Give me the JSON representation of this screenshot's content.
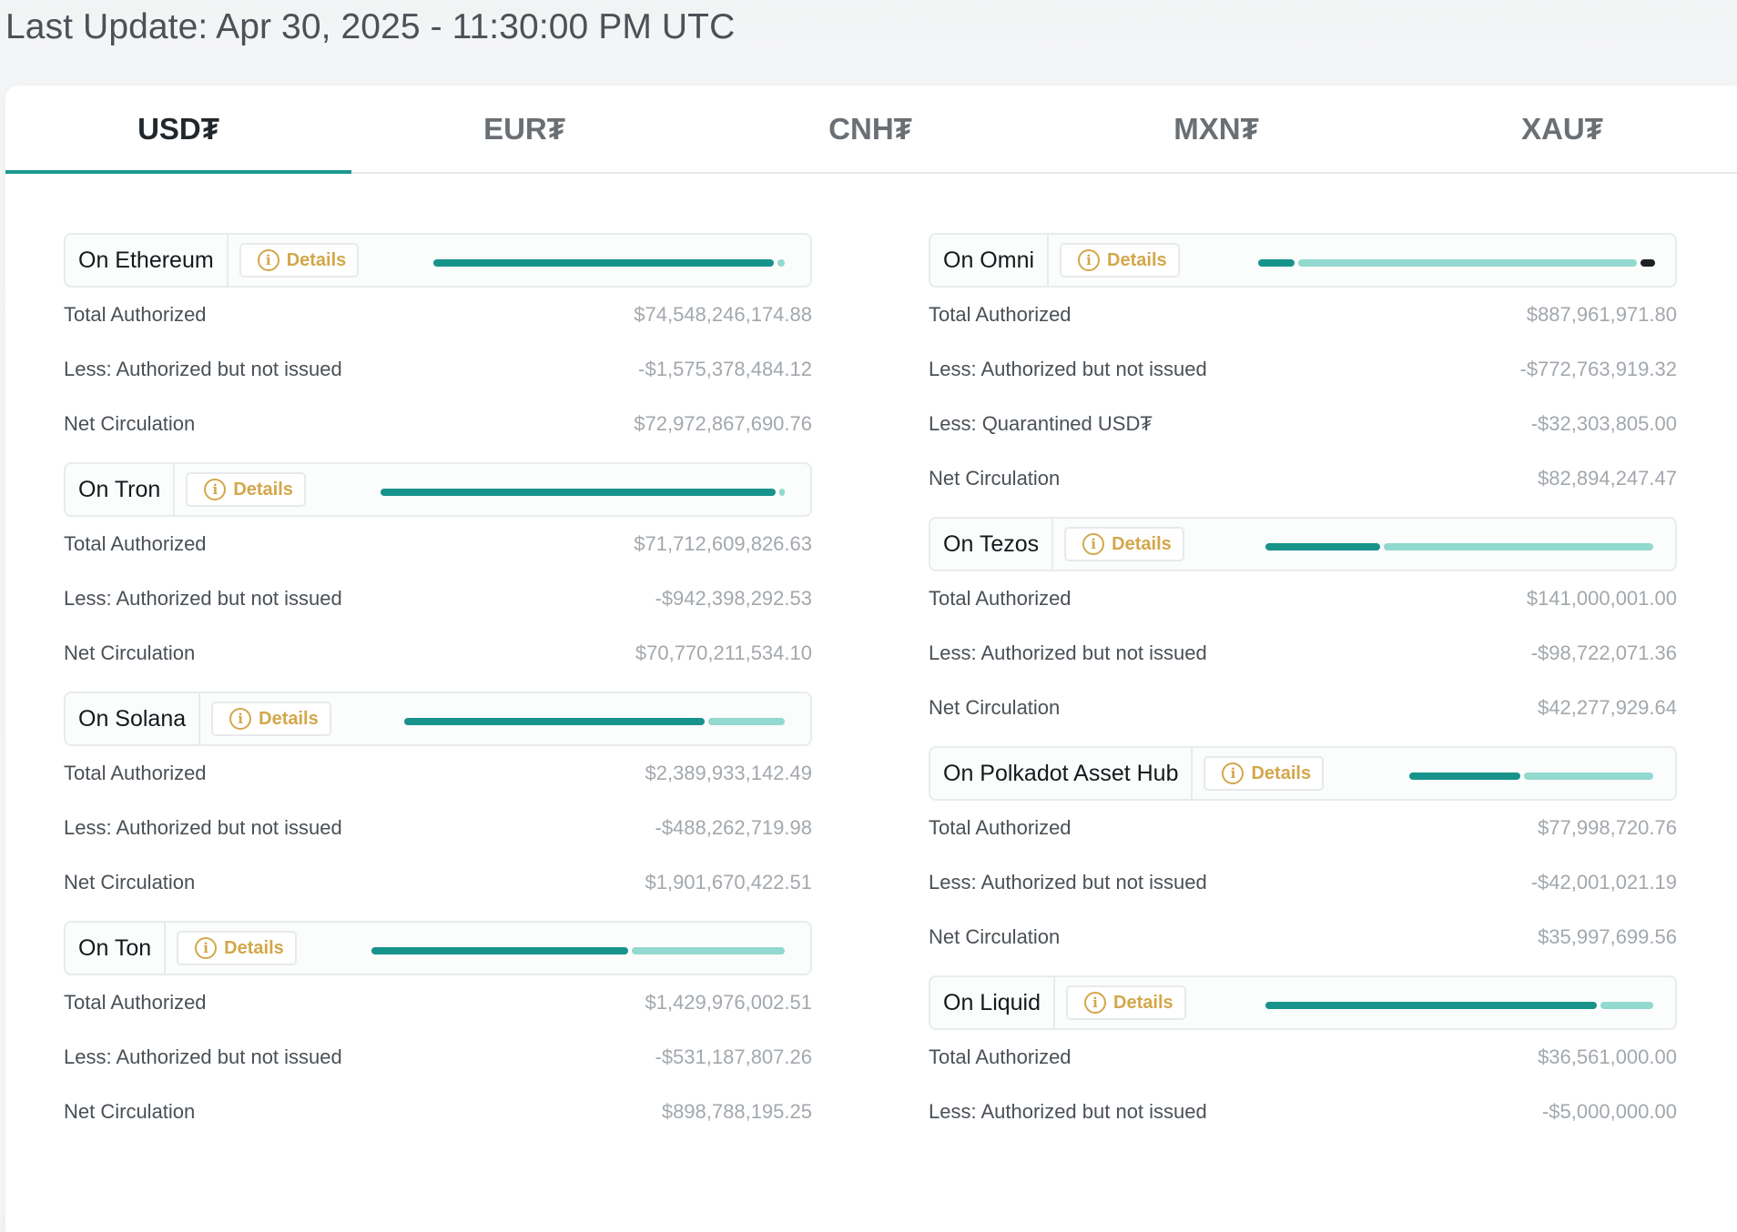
{
  "header": {
    "last_update": "Last Update: Apr 30, 2025 - 11:30:00 PM UTC"
  },
  "tabs": [
    {
      "label": "USD₮",
      "active": true
    },
    {
      "label": "EUR₮",
      "active": false
    },
    {
      "label": "CNH₮",
      "active": false
    },
    {
      "label": "MXN₮",
      "active": false
    },
    {
      "label": "XAU₮",
      "active": false
    }
  ],
  "details_label": "Details",
  "colors": {
    "accent": "#1a9991",
    "bar_dark": "#17938b",
    "bar_light": "#92d9cf",
    "details": "#d3a74a"
  },
  "left": [
    {
      "name": "On Ethereum",
      "rows": [
        {
          "label": "Total Authorized",
          "value": "$74,548,246,174.88"
        },
        {
          "label": "Less: Authorized but not issued",
          "value": "-$1,575,378,484.12"
        },
        {
          "label": "Net Circulation",
          "value": "$72,972,867,690.76"
        }
      ]
    },
    {
      "name": "On Tron",
      "rows": [
        {
          "label": "Total Authorized",
          "value": "$71,712,609,826.63"
        },
        {
          "label": "Less: Authorized but not issued",
          "value": "-$942,398,292.53"
        },
        {
          "label": "Net Circulation",
          "value": "$70,770,211,534.10"
        }
      ]
    },
    {
      "name": "On Solana",
      "rows": [
        {
          "label": "Total Authorized",
          "value": "$2,389,933,142.49"
        },
        {
          "label": "Less: Authorized but not issued",
          "value": "-$488,262,719.98"
        },
        {
          "label": "Net Circulation",
          "value": "$1,901,670,422.51"
        }
      ]
    },
    {
      "name": "On Ton",
      "rows": [
        {
          "label": "Total Authorized",
          "value": "$1,429,976,002.51"
        },
        {
          "label": "Less: Authorized but not issued",
          "value": "-$531,187,807.26"
        },
        {
          "label": "Net Circulation",
          "value": "$898,788,195.25"
        }
      ]
    }
  ],
  "right": [
    {
      "name": "On Omni",
      "rows": [
        {
          "label": "Total Authorized",
          "value": "$887,961,971.80"
        },
        {
          "label": "Less: Authorized but not issued",
          "value": "-$772,763,919.32"
        },
        {
          "label": "Less: Quarantined USD₮",
          "value": "-$32,303,805.00"
        },
        {
          "label": "Net Circulation",
          "value": "$82,894,247.47"
        }
      ]
    },
    {
      "name": "On Tezos",
      "rows": [
        {
          "label": "Total Authorized",
          "value": "$141,000,001.00"
        },
        {
          "label": "Less: Authorized but not issued",
          "value": "-$98,722,071.36"
        },
        {
          "label": "Net Circulation",
          "value": "$42,277,929.64"
        }
      ]
    },
    {
      "name": "On Polkadot Asset Hub",
      "rows": [
        {
          "label": "Total Authorized",
          "value": "$77,998,720.76"
        },
        {
          "label": "Less: Authorized but not issued",
          "value": "-$42,001,021.19"
        },
        {
          "label": "Net Circulation",
          "value": "$35,997,699.56"
        }
      ]
    },
    {
      "name": "On Liquid",
      "rows": [
        {
          "label": "Total Authorized",
          "value": "$36,561,000.00"
        },
        {
          "label": "Less: Authorized but not issued",
          "value": "-$5,000,000.00"
        }
      ]
    }
  ]
}
